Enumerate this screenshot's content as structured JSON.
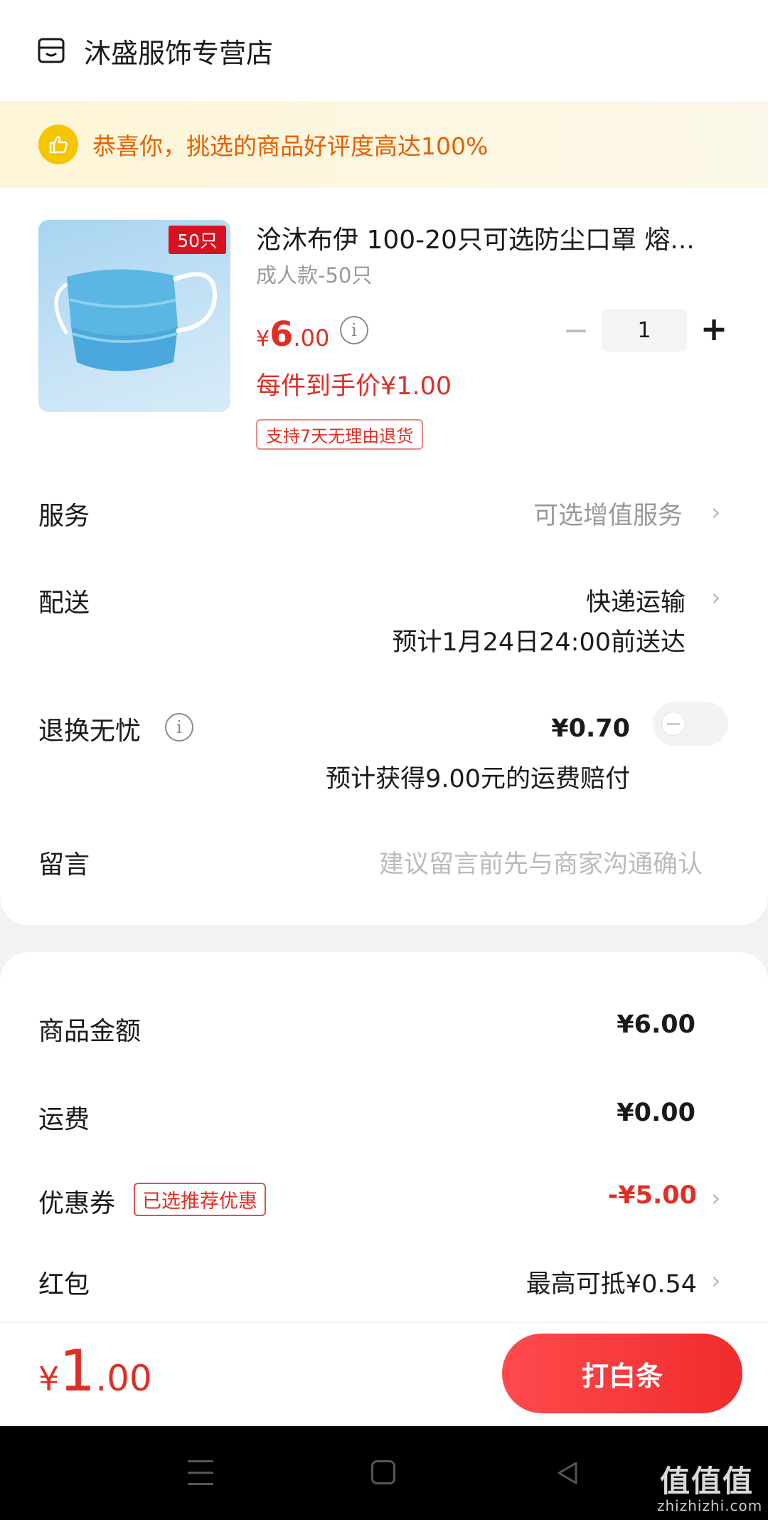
{
  "store": {
    "name": "沐盛服饰专营店",
    "icon": "store-icon"
  },
  "banner": {
    "text": "恭喜你，挑选的商品好评度高达100%",
    "icon": "thumbs-up-icon"
  },
  "product": {
    "image_badge": "50只",
    "title": "沧沐布伊 100-20只可选防尘口罩 熔...",
    "spec": "成人款-50只",
    "price_yen": "¥",
    "price_int": "6",
    "price_dec": ".00",
    "each_price": "每件到手价¥1.00",
    "return_tag": "支持7天无理由退货",
    "quantity": "1",
    "minus_label": "−",
    "plus_label": "+"
  },
  "service": {
    "label": "服务",
    "value": "可选增值服务"
  },
  "delivery": {
    "label": "配送",
    "value": "快递运输",
    "eta": "预计1月24日24:00前送达"
  },
  "return_insurance": {
    "label": "退换无忧",
    "price": "¥0.70",
    "note": "预计获得9.00元的运费赔付",
    "enabled": false
  },
  "message": {
    "label": "留言",
    "placeholder": "建议留言前先与商家沟通确认"
  },
  "summary": {
    "goods_label": "商品金额",
    "goods_value": "¥6.00",
    "shipping_label": "运费",
    "shipping_value": "¥0.00",
    "coupon_label": "优惠券",
    "coupon_tag": "已选推荐优惠",
    "coupon_value": "-¥5.00",
    "redpacket_label": "红包",
    "redpacket_value": "最高可抵¥0.54"
  },
  "checkout": {
    "total_yen": "¥",
    "total_int": "1",
    "total_dec": ".00",
    "button_label": "打白条"
  },
  "watermark": {
    "text": "值值值",
    "sub": "zhizhizhi.com"
  },
  "colors": {
    "accent": "#e02e24",
    "banner_text": "#e46000",
    "banner_bg": "#fdf5d6",
    "icon_yellow": "#f6c500"
  }
}
